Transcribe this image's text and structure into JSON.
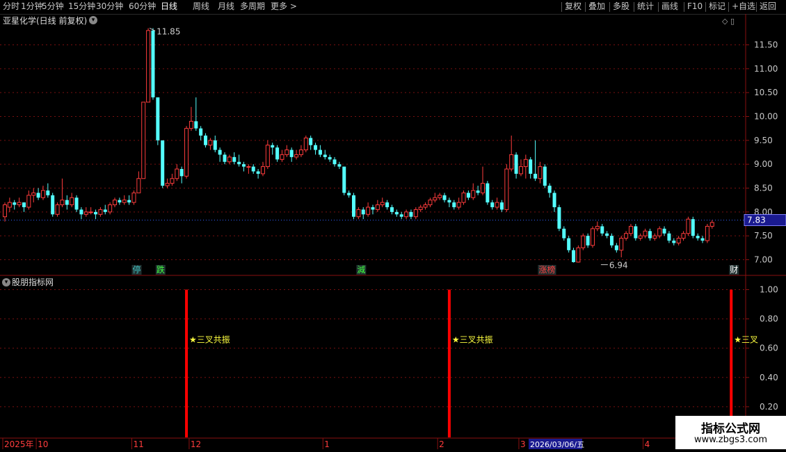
{
  "toolbar": {
    "left_items": [
      "分时",
      "1分钟",
      "5分钟",
      "15分钟",
      "30分钟",
      "60分钟",
      "日线",
      "周线",
      "月线",
      "多周期",
      "更多 >"
    ],
    "active": "日线",
    "right_items": [
      "复权",
      "叠加",
      "多股",
      "统计",
      "画线",
      "F10",
      "标记",
      "+自选",
      "返回"
    ]
  },
  "stock_title": "亚星化学(日线 前复权)",
  "indicator_title": "股朋指标网",
  "price_axis": {
    "labels": [
      "11.50",
      "11.00",
      "10.50",
      "10.00",
      "9.50",
      "9.00",
      "8.50",
      "8.00",
      "7.50",
      "7.00"
    ],
    "current_price": "7.83"
  },
  "indicator_axis": {
    "labels": [
      "1.00",
      "0.80",
      "0.60",
      "0.40",
      "0.20"
    ]
  },
  "annotations": {
    "high": "11.85",
    "low": "6.94"
  },
  "event_tags": [
    {
      "text": "停",
      "color": "#40c0c0",
      "bar": 27
    },
    {
      "text": "跌",
      "color": "#40ff40",
      "bar": 32
    },
    {
      "text": "減",
      "color": "#40ff40",
      "bar": 74
    },
    {
      "text": "涨榜",
      "color": "#ff4040",
      "bar": 112
    },
    {
      "text": "财",
      "color": "#ffffff",
      "bar": 152
    }
  ],
  "signals": [
    {
      "bar": 38,
      "label": "★三叉共振"
    },
    {
      "bar": 93,
      "label": "★三叉共振"
    },
    {
      "bar": 152,
      "label": "★三叉"
    }
  ],
  "date_axis": {
    "labels": [
      {
        "text": "2025年",
        "bar": 0
      },
      {
        "text": "10",
        "bar": 7
      },
      {
        "text": "11",
        "bar": 27
      },
      {
        "text": "12",
        "bar": 39
      },
      {
        "text": "1",
        "bar": 67
      },
      {
        "text": "2",
        "bar": 91
      },
      {
        "text": "3",
        "bar": 108
      },
      {
        "text": "4",
        "bar": 134
      }
    ],
    "cursor_date": "2026/03/06/五"
  },
  "watermark": {
    "line1": "指标公式网",
    "line2": "www.zbgs3.com"
  },
  "colors": {
    "up": "#ff3c3c",
    "down": "#54ffff",
    "grid": "#7a1010",
    "axis_text": "#c8c8c8",
    "current_price_bg": "#1a1a90",
    "signal": "#ff0000",
    "signal_label": "#ffff40"
  },
  "chart_data": {
    "type": "candlestick",
    "title": "亚星化学(日线 前复权)",
    "ylim": [
      6.8,
      11.9
    ],
    "candles": [
      [
        7.9,
        8.15,
        8.2,
        7.8
      ],
      [
        8.1,
        8.2,
        8.3,
        8.0
      ],
      [
        8.2,
        8.15,
        8.25,
        8.05
      ],
      [
        8.15,
        8.2,
        8.3,
        8.1
      ],
      [
        8.2,
        8.1,
        8.2,
        8.0
      ],
      [
        8.1,
        8.35,
        8.45,
        8.05
      ],
      [
        8.35,
        8.4,
        8.5,
        8.2
      ],
      [
        8.4,
        8.3,
        8.5,
        8.25
      ],
      [
        8.3,
        8.45,
        8.55,
        8.25
      ],
      [
        8.45,
        8.35,
        8.6,
        8.3
      ],
      [
        8.35,
        7.95,
        8.4,
        7.9
      ],
      [
        7.95,
        8.15,
        8.2,
        7.9
      ],
      [
        8.15,
        8.25,
        8.7,
        8.1
      ],
      [
        8.25,
        8.15,
        8.35,
        8.05
      ],
      [
        8.15,
        8.3,
        8.4,
        8.1
      ],
      [
        8.3,
        8.05,
        8.35,
        8.0
      ],
      [
        8.05,
        7.95,
        8.1,
        7.85
      ],
      [
        7.95,
        8.0,
        8.1,
        7.9
      ],
      [
        8.0,
        8.0,
        8.1,
        7.95
      ],
      [
        8.0,
        7.95,
        8.05,
        7.85
      ],
      [
        7.95,
        8.05,
        8.1,
        7.9
      ],
      [
        8.05,
        8.0,
        8.15,
        7.95
      ],
      [
        8.0,
        8.15,
        8.2,
        7.95
      ],
      [
        8.15,
        8.25,
        8.3,
        8.1
      ],
      [
        8.25,
        8.2,
        8.3,
        8.15
      ],
      [
        8.2,
        8.25,
        8.35,
        8.15
      ],
      [
        8.25,
        8.2,
        8.35,
        8.15
      ],
      [
        8.2,
        8.4,
        8.45,
        8.15
      ],
      [
        8.4,
        8.7,
        8.85,
        8.4
      ],
      [
        8.7,
        10.3,
        10.3,
        8.7
      ],
      [
        10.3,
        11.8,
        11.85,
        10.3
      ],
      [
        11.8,
        10.4,
        11.85,
        10.35
      ],
      [
        10.4,
        9.5,
        10.0,
        9.4
      ],
      [
        9.5,
        8.55,
        8.9,
        8.5
      ],
      [
        8.55,
        8.6,
        8.7,
        8.5
      ],
      [
        8.6,
        8.7,
        8.8,
        8.55
      ],
      [
        8.7,
        8.9,
        9.0,
        8.65
      ],
      [
        8.9,
        8.75,
        8.95,
        8.6
      ],
      [
        8.75,
        9.75,
        9.8,
        8.7
      ],
      [
        9.75,
        9.9,
        10.2,
        9.7
      ],
      [
        9.9,
        9.75,
        10.4,
        9.7
      ],
      [
        9.75,
        9.6,
        9.8,
        9.5
      ],
      [
        9.6,
        9.4,
        9.65,
        9.35
      ],
      [
        9.4,
        9.5,
        9.55,
        9.3
      ],
      [
        9.5,
        9.3,
        9.6,
        9.25
      ],
      [
        9.3,
        9.2,
        9.35,
        9.05
      ],
      [
        9.2,
        9.05,
        9.25,
        9.0
      ],
      [
        9.05,
        9.15,
        9.2,
        9.0
      ],
      [
        9.15,
        9.05,
        9.25,
        9.0
      ],
      [
        9.05,
        9.0,
        9.2,
        8.95
      ],
      [
        9.0,
        8.95,
        9.05,
        8.85
      ],
      [
        8.95,
        8.95,
        9.0,
        8.8
      ],
      [
        8.95,
        8.85,
        9.0,
        8.8
      ],
      [
        8.85,
        8.8,
        8.9,
        8.7
      ],
      [
        8.8,
        8.95,
        9.05,
        8.75
      ],
      [
        8.95,
        9.4,
        9.5,
        8.9
      ],
      [
        9.4,
        9.35,
        9.45,
        9.2
      ],
      [
        9.35,
        9.1,
        9.4,
        9.05
      ],
      [
        9.1,
        9.2,
        9.3,
        9.05
      ],
      [
        9.2,
        9.3,
        9.4,
        9.15
      ],
      [
        9.3,
        9.15,
        9.35,
        9.05
      ],
      [
        9.15,
        9.2,
        9.3,
        9.1
      ],
      [
        9.2,
        9.3,
        9.4,
        9.15
      ],
      [
        9.3,
        9.55,
        9.6,
        9.25
      ],
      [
        9.55,
        9.4,
        9.6,
        9.3
      ],
      [
        9.4,
        9.3,
        9.45,
        9.2
      ],
      [
        9.3,
        9.2,
        9.4,
        9.15
      ],
      [
        9.2,
        9.15,
        9.3,
        9.1
      ],
      [
        9.15,
        9.1,
        9.2,
        9.05
      ],
      [
        9.1,
        9.0,
        9.15,
        8.95
      ],
      [
        9.0,
        8.95,
        9.05,
        8.9
      ],
      [
        8.95,
        8.4,
        8.95,
        8.35
      ],
      [
        8.4,
        8.35,
        8.45,
        8.3
      ],
      [
        8.35,
        7.9,
        8.4,
        7.85
      ],
      [
        7.9,
        8.05,
        8.1,
        7.85
      ],
      [
        8.05,
        7.95,
        8.1,
        7.85
      ],
      [
        7.95,
        8.1,
        8.2,
        7.9
      ],
      [
        8.1,
        8.05,
        8.15,
        7.95
      ],
      [
        8.05,
        8.15,
        8.25,
        8.0
      ],
      [
        8.15,
        8.2,
        8.3,
        8.1
      ],
      [
        8.2,
        8.1,
        8.25,
        8.05
      ],
      [
        8.1,
        8.0,
        8.15,
        7.95
      ],
      [
        8.0,
        7.95,
        8.05,
        7.9
      ],
      [
        7.95,
        7.9,
        8.0,
        7.85
      ],
      [
        7.9,
        8.0,
        8.05,
        7.85
      ],
      [
        8.0,
        7.9,
        8.05,
        7.85
      ],
      [
        7.9,
        8.05,
        8.1,
        7.85
      ],
      [
        8.05,
        8.1,
        8.15,
        8.0
      ],
      [
        8.1,
        8.15,
        8.2,
        8.05
      ],
      [
        8.15,
        8.25,
        8.3,
        8.1
      ],
      [
        8.25,
        8.3,
        8.4,
        8.2
      ],
      [
        8.3,
        8.35,
        8.4,
        8.25
      ],
      [
        8.35,
        8.25,
        8.4,
        8.2
      ],
      [
        8.25,
        8.2,
        8.3,
        8.1
      ],
      [
        8.2,
        8.1,
        8.25,
        8.05
      ],
      [
        8.1,
        8.2,
        8.3,
        8.05
      ],
      [
        8.2,
        8.4,
        8.45,
        8.15
      ],
      [
        8.4,
        8.3,
        8.45,
        8.25
      ],
      [
        8.3,
        8.45,
        8.6,
        8.25
      ],
      [
        8.45,
        8.4,
        8.55,
        8.35
      ],
      [
        8.4,
        8.6,
        8.95,
        8.35
      ],
      [
        8.6,
        8.2,
        8.65,
        8.15
      ],
      [
        8.2,
        8.1,
        8.25,
        8.05
      ],
      [
        8.1,
        8.2,
        8.3,
        8.05
      ],
      [
        8.2,
        8.05,
        8.25,
        8.0
      ],
      [
        8.05,
        8.9,
        9.0,
        8.0
      ],
      [
        8.9,
        9.2,
        9.6,
        8.85
      ],
      [
        9.2,
        8.8,
        9.25,
        8.7
      ],
      [
        8.8,
        8.95,
        9.1,
        8.75
      ],
      [
        8.95,
        9.1,
        9.2,
        8.7
      ],
      [
        9.1,
        8.8,
        9.15,
        8.7
      ],
      [
        8.8,
        8.7,
        9.5,
        8.65
      ],
      [
        8.7,
        8.95,
        9.05,
        8.6
      ],
      [
        8.95,
        8.55,
        9.0,
        8.5
      ],
      [
        8.55,
        8.4,
        8.6,
        8.3
      ],
      [
        8.4,
        8.1,
        8.45,
        8.0
      ],
      [
        8.1,
        7.65,
        8.15,
        7.6
      ],
      [
        7.65,
        7.45,
        7.7,
        7.4
      ],
      [
        7.45,
        7.2,
        7.5,
        7.15
      ],
      [
        7.2,
        6.95,
        7.25,
        6.94
      ],
      [
        6.95,
        7.25,
        7.3,
        6.94
      ],
      [
        7.25,
        7.5,
        7.55,
        7.2
      ],
      [
        7.5,
        7.3,
        7.55,
        7.25
      ],
      [
        7.3,
        7.65,
        7.7,
        7.25
      ],
      [
        7.65,
        7.7,
        7.8,
        7.6
      ],
      [
        7.7,
        7.55,
        7.75,
        7.5
      ],
      [
        7.55,
        7.5,
        7.6,
        7.45
      ],
      [
        7.5,
        7.3,
        7.55,
        7.25
      ],
      [
        7.3,
        7.2,
        7.35,
        7.15
      ],
      [
        7.2,
        7.45,
        7.5,
        7.05
      ],
      [
        7.45,
        7.55,
        7.6,
        7.4
      ],
      [
        7.55,
        7.7,
        7.75,
        7.5
      ],
      [
        7.7,
        7.45,
        7.75,
        7.4
      ],
      [
        7.45,
        7.5,
        7.55,
        7.4
      ],
      [
        7.5,
        7.6,
        7.65,
        7.45
      ],
      [
        7.6,
        7.45,
        7.65,
        7.4
      ],
      [
        7.45,
        7.5,
        7.55,
        7.4
      ],
      [
        7.5,
        7.65,
        7.7,
        7.45
      ],
      [
        7.65,
        7.55,
        7.7,
        7.5
      ],
      [
        7.55,
        7.4,
        7.6,
        7.35
      ],
      [
        7.4,
        7.35,
        7.45,
        7.3
      ],
      [
        7.35,
        7.45,
        7.5,
        7.3
      ],
      [
        7.45,
        7.55,
        7.6,
        7.4
      ],
      [
        7.55,
        7.85,
        7.9,
        7.5
      ],
      [
        7.85,
        7.5,
        7.9,
        7.45
      ],
      [
        7.5,
        7.45,
        7.55,
        7.4
      ],
      [
        7.45,
        7.4,
        7.5,
        7.35
      ],
      [
        7.4,
        7.7,
        7.75,
        7.35
      ],
      [
        7.7,
        7.78,
        7.83,
        7.65
      ]
    ]
  }
}
